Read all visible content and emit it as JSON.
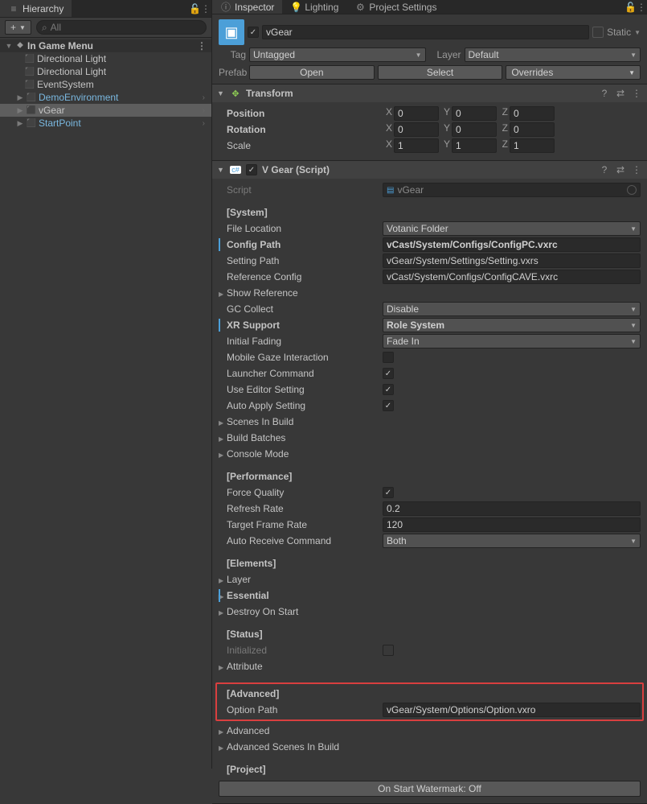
{
  "hierarchy": {
    "tab": "Hierarchy",
    "search_placeholder": "All",
    "plus": "+",
    "scene": "In Game Menu",
    "items": [
      {
        "label": "Directional Light",
        "blue": false
      },
      {
        "label": "Directional Light",
        "blue": false
      },
      {
        "label": "EventSystem",
        "blue": false
      },
      {
        "label": "DemoEnvironment",
        "blue": true
      },
      {
        "label": "vGear",
        "blue": false
      },
      {
        "label": "StartPoint",
        "blue": true
      }
    ]
  },
  "tabs": {
    "inspector": "Inspector",
    "lighting": "Lighting",
    "project_settings": "Project Settings"
  },
  "header": {
    "name": "vGear",
    "static_label": "Static",
    "tag_label": "Tag",
    "tag_value": "Untagged",
    "layer_label": "Layer",
    "layer_value": "Default",
    "prefab_label": "Prefab",
    "open": "Open",
    "select": "Select",
    "overrides": "Overrides"
  },
  "transform": {
    "title": "Transform",
    "position": "Position",
    "rotation": "Rotation",
    "scale": "Scale",
    "px": "0",
    "py": "0",
    "pz": "0",
    "rx": "0",
    "ry": "0",
    "rz": "0",
    "sx": "1",
    "sy": "1",
    "sz": "1"
  },
  "script": {
    "title": "V Gear (Script)",
    "script_label": "Script",
    "script_value": "vGear",
    "sec_system": "[System]",
    "file_location_l": "File Location",
    "file_location_v": "Votanic Folder",
    "config_path_l": "Config Path",
    "config_path_v": "vCast/System/Configs/ConfigPC.vxrc",
    "setting_path_l": "Setting Path",
    "setting_path_v": "vGear/System/Settings/Setting.vxrs",
    "ref_config_l": "Reference Config",
    "ref_config_v": "vCast/System/Configs/ConfigCAVE.vxrc",
    "show_ref_l": "Show Reference",
    "gc_l": "GC Collect",
    "gc_v": "Disable",
    "xr_l": "XR Support",
    "xr_v": "Role System",
    "fade_l": "Initial Fading",
    "fade_v": "Fade In",
    "gaze_l": "Mobile Gaze Interaction",
    "launcher_l": "Launcher Command",
    "editor_l": "Use Editor Setting",
    "apply_l": "Auto Apply Setting",
    "scenes_l": "Scenes In Build",
    "batches_l": "Build Batches",
    "console_l": "Console Mode",
    "sec_perf": "[Performance]",
    "force_q_l": "Force Quality",
    "refresh_l": "Refresh Rate",
    "refresh_v": "0.2",
    "target_fr_l": "Target Frame Rate",
    "target_fr_v": "120",
    "auto_rec_l": "Auto Receive Command",
    "auto_rec_v": "Both",
    "sec_elem": "[Elements]",
    "layer_l": "Layer",
    "essential_l": "Essential",
    "destroy_l": "Destroy On Start",
    "sec_status": "[Status]",
    "initialized_l": "Initialized",
    "attribute_l": "Attribute",
    "sec_adv": "[Advanced]",
    "option_l": "Option Path",
    "option_v": "vGear/System/Options/Option.vxro",
    "advanced_l": "Advanced",
    "adv_scenes_l": "Advanced Scenes In Build",
    "sec_project": "[Project]",
    "watermark": "On Start Watermark: Off"
  }
}
